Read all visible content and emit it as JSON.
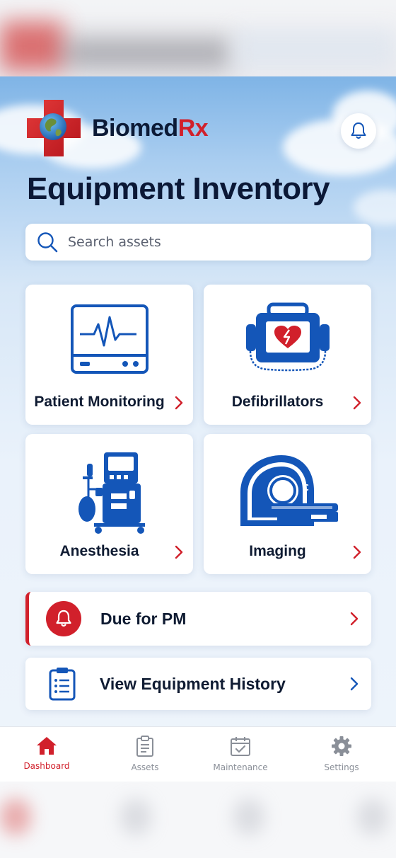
{
  "brand": {
    "name_part1": "Biomed",
    "name_part2": "Rx"
  },
  "page": {
    "title": "Equipment Inventory"
  },
  "search": {
    "placeholder": "Search assets"
  },
  "categories": [
    {
      "label": "Patient Monitoring",
      "icon": "patient-monitor-icon"
    },
    {
      "label": "Defibrillators",
      "icon": "defibrillator-icon"
    },
    {
      "label": "Anesthesia",
      "icon": "anesthesia-machine-icon"
    },
    {
      "label": "Imaging",
      "icon": "ct-scanner-icon"
    }
  ],
  "actions": [
    {
      "label": "Due for PM",
      "icon": "bell-icon"
    },
    {
      "label": "View Equipment History",
      "icon": "clipboard-icon"
    }
  ],
  "tabs": [
    {
      "label": "Dashboard",
      "icon": "home-icon",
      "active": true
    },
    {
      "label": "Assets",
      "icon": "assets-icon",
      "active": false
    },
    {
      "label": "Maintenance",
      "icon": "calendar-check-icon",
      "active": false
    },
    {
      "label": "Settings",
      "icon": "gear-icon",
      "active": false
    }
  ],
  "colors": {
    "primary_blue": "#1456b8",
    "accent_red": "#d1202b",
    "text_dark": "#0b1836"
  }
}
